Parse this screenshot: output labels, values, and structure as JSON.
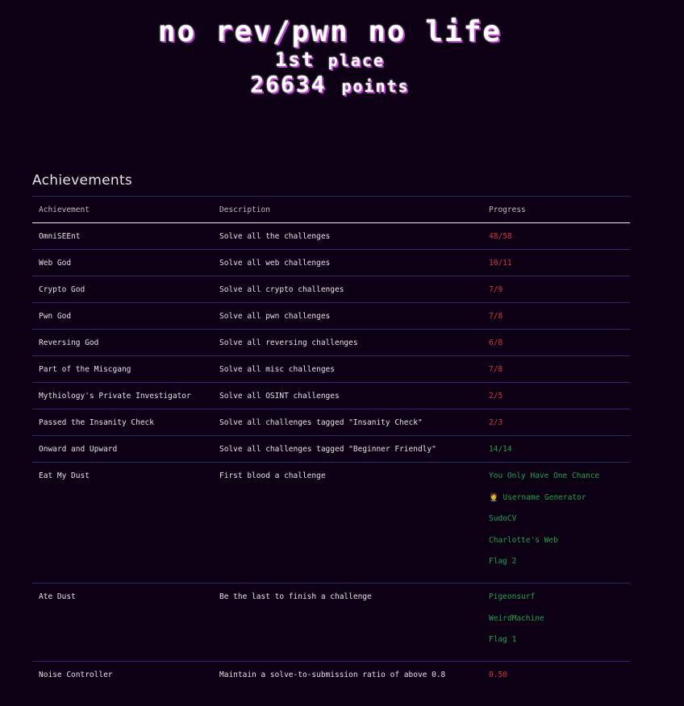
{
  "header": {
    "team_name": "no rev/pwn no life",
    "place_rank": "1st",
    "place_word": "place",
    "points_value": "26634",
    "points_word": "points"
  },
  "achievements": {
    "title": "Achievements",
    "columns": [
      "Achievement",
      "Description",
      "Progress"
    ],
    "rows": [
      {
        "name": "OmniSEEnt",
        "description": "Solve all the challenges",
        "progress": "48/58",
        "status": "incomplete"
      },
      {
        "name": "Web God",
        "description": "Solve all web challenges",
        "progress": "10/11",
        "status": "incomplete"
      },
      {
        "name": "Crypto God",
        "description": "Solve all crypto challenges",
        "progress": "7/9",
        "status": "incomplete"
      },
      {
        "name": "Pwn God",
        "description": "Solve all pwn challenges",
        "progress": "7/8",
        "status": "incomplete"
      },
      {
        "name": "Reversing God",
        "description": "Solve all reversing challenges",
        "progress": "6/8",
        "status": "incomplete"
      },
      {
        "name": "Part of the Miscgang",
        "description": "Solve all misc challenges",
        "progress": "7/8",
        "status": "incomplete"
      },
      {
        "name": "Mythiology's Private Investigator",
        "description": "Solve all OSINT challenges",
        "progress": "2/5",
        "status": "incomplete"
      },
      {
        "name": "Passed the Insanity Check",
        "description": "Solve all challenges tagged \"Insanity Check\"",
        "progress": "2/3",
        "status": "incomplete"
      },
      {
        "name": "Onward and Upward",
        "description": "Solve all challenges tagged \"Beginner Friendly\"",
        "progress": "14/14",
        "status": "complete"
      }
    ],
    "list_rows": [
      {
        "name": "Eat My Dust",
        "description": "First blood a challenge",
        "items": [
          "You Only Have One Chance",
          "🤵 Username Generator",
          "SudoCV",
          "Charlotte's Web",
          "Flag 2"
        ]
      },
      {
        "name": "Ate Dust",
        "description": "Be the last to finish a challenge",
        "items": [
          "Pigeonsurf",
          "WeirdMachine",
          "Flag 1"
        ]
      }
    ],
    "last_row": {
      "name": "Noise Controller",
      "description": "Maintain a solve-to-submission ratio of above 0.8",
      "progress": "0.50",
      "status": "incomplete"
    }
  },
  "colors": {
    "background": "#0d0014",
    "incomplete": "#d23a3a",
    "complete": "#22a34a",
    "row_border": "#2a2a78",
    "title_shadow": "#c23fd6"
  }
}
